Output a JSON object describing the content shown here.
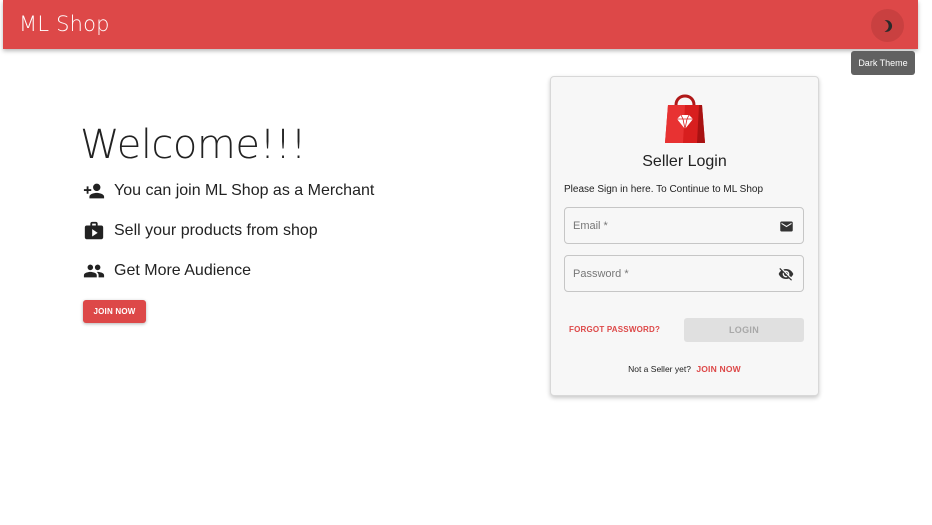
{
  "appbar": {
    "title": "ML Shop",
    "theme_tooltip": "Dark Theme",
    "theme_icon": "moon-icon",
    "color": "#dd4848"
  },
  "hero": {
    "welcome": "Welcome!!!",
    "features": [
      {
        "icon": "person-add-icon",
        "text": "You can join ML Shop as a Merchant"
      },
      {
        "icon": "business-center-icon",
        "text": "Sell your products from shop"
      },
      {
        "icon": "people-icon",
        "text": "Get More Audience"
      }
    ],
    "join_label": "JOIN NOW"
  },
  "login": {
    "logo_icon": "shopping-bag-logo",
    "title": "Seller Login",
    "subtitle": "Please Sign in here. To Continue to ML Shop",
    "email": {
      "placeholder": "Email *",
      "value": "",
      "icon": "mail-icon"
    },
    "password": {
      "placeholder": "Password *",
      "value": "",
      "icon": "visibility-off-icon"
    },
    "forgot_label": "FORGOT PASSWORD?",
    "login_label": "LOGIN",
    "not_seller_text": "Not a Seller yet?",
    "join_link": "JOIN NOW"
  },
  "colors": {
    "accent": "#dd4848",
    "disabled_bg": "#e0e0e0",
    "disabled_text": "#a8a8a8"
  }
}
